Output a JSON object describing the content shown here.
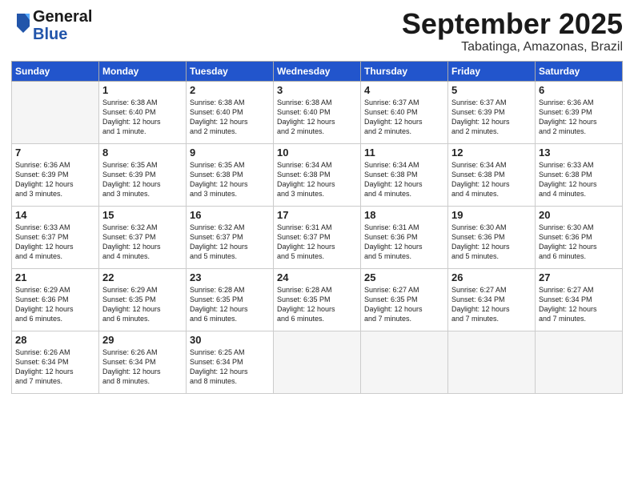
{
  "logo": {
    "line1": "General",
    "line2": "Blue"
  },
  "title": "September 2025",
  "location": "Tabatinga, Amazonas, Brazil",
  "days_of_week": [
    "Sunday",
    "Monday",
    "Tuesday",
    "Wednesday",
    "Thursday",
    "Friday",
    "Saturday"
  ],
  "weeks": [
    [
      {
        "num": "",
        "text": ""
      },
      {
        "num": "1",
        "text": "Sunrise: 6:38 AM\nSunset: 6:40 PM\nDaylight: 12 hours\nand 1 minute."
      },
      {
        "num": "2",
        "text": "Sunrise: 6:38 AM\nSunset: 6:40 PM\nDaylight: 12 hours\nand 2 minutes."
      },
      {
        "num": "3",
        "text": "Sunrise: 6:38 AM\nSunset: 6:40 PM\nDaylight: 12 hours\nand 2 minutes."
      },
      {
        "num": "4",
        "text": "Sunrise: 6:37 AM\nSunset: 6:40 PM\nDaylight: 12 hours\nand 2 minutes."
      },
      {
        "num": "5",
        "text": "Sunrise: 6:37 AM\nSunset: 6:39 PM\nDaylight: 12 hours\nand 2 minutes."
      },
      {
        "num": "6",
        "text": "Sunrise: 6:36 AM\nSunset: 6:39 PM\nDaylight: 12 hours\nand 2 minutes."
      }
    ],
    [
      {
        "num": "7",
        "text": "Sunrise: 6:36 AM\nSunset: 6:39 PM\nDaylight: 12 hours\nand 3 minutes."
      },
      {
        "num": "8",
        "text": "Sunrise: 6:35 AM\nSunset: 6:39 PM\nDaylight: 12 hours\nand 3 minutes."
      },
      {
        "num": "9",
        "text": "Sunrise: 6:35 AM\nSunset: 6:38 PM\nDaylight: 12 hours\nand 3 minutes."
      },
      {
        "num": "10",
        "text": "Sunrise: 6:34 AM\nSunset: 6:38 PM\nDaylight: 12 hours\nand 3 minutes."
      },
      {
        "num": "11",
        "text": "Sunrise: 6:34 AM\nSunset: 6:38 PM\nDaylight: 12 hours\nand 4 minutes."
      },
      {
        "num": "12",
        "text": "Sunrise: 6:34 AM\nSunset: 6:38 PM\nDaylight: 12 hours\nand 4 minutes."
      },
      {
        "num": "13",
        "text": "Sunrise: 6:33 AM\nSunset: 6:38 PM\nDaylight: 12 hours\nand 4 minutes."
      }
    ],
    [
      {
        "num": "14",
        "text": "Sunrise: 6:33 AM\nSunset: 6:37 PM\nDaylight: 12 hours\nand 4 minutes."
      },
      {
        "num": "15",
        "text": "Sunrise: 6:32 AM\nSunset: 6:37 PM\nDaylight: 12 hours\nand 4 minutes."
      },
      {
        "num": "16",
        "text": "Sunrise: 6:32 AM\nSunset: 6:37 PM\nDaylight: 12 hours\nand 5 minutes."
      },
      {
        "num": "17",
        "text": "Sunrise: 6:31 AM\nSunset: 6:37 PM\nDaylight: 12 hours\nand 5 minutes."
      },
      {
        "num": "18",
        "text": "Sunrise: 6:31 AM\nSunset: 6:36 PM\nDaylight: 12 hours\nand 5 minutes."
      },
      {
        "num": "19",
        "text": "Sunrise: 6:30 AM\nSunset: 6:36 PM\nDaylight: 12 hours\nand 5 minutes."
      },
      {
        "num": "20",
        "text": "Sunrise: 6:30 AM\nSunset: 6:36 PM\nDaylight: 12 hours\nand 6 minutes."
      }
    ],
    [
      {
        "num": "21",
        "text": "Sunrise: 6:29 AM\nSunset: 6:36 PM\nDaylight: 12 hours\nand 6 minutes."
      },
      {
        "num": "22",
        "text": "Sunrise: 6:29 AM\nSunset: 6:35 PM\nDaylight: 12 hours\nand 6 minutes."
      },
      {
        "num": "23",
        "text": "Sunrise: 6:28 AM\nSunset: 6:35 PM\nDaylight: 12 hours\nand 6 minutes."
      },
      {
        "num": "24",
        "text": "Sunrise: 6:28 AM\nSunset: 6:35 PM\nDaylight: 12 hours\nand 6 minutes."
      },
      {
        "num": "25",
        "text": "Sunrise: 6:27 AM\nSunset: 6:35 PM\nDaylight: 12 hours\nand 7 minutes."
      },
      {
        "num": "26",
        "text": "Sunrise: 6:27 AM\nSunset: 6:34 PM\nDaylight: 12 hours\nand 7 minutes."
      },
      {
        "num": "27",
        "text": "Sunrise: 6:27 AM\nSunset: 6:34 PM\nDaylight: 12 hours\nand 7 minutes."
      }
    ],
    [
      {
        "num": "28",
        "text": "Sunrise: 6:26 AM\nSunset: 6:34 PM\nDaylight: 12 hours\nand 7 minutes."
      },
      {
        "num": "29",
        "text": "Sunrise: 6:26 AM\nSunset: 6:34 PM\nDaylight: 12 hours\nand 8 minutes."
      },
      {
        "num": "30",
        "text": "Sunrise: 6:25 AM\nSunset: 6:34 PM\nDaylight: 12 hours\nand 8 minutes."
      },
      {
        "num": "",
        "text": ""
      },
      {
        "num": "",
        "text": ""
      },
      {
        "num": "",
        "text": ""
      },
      {
        "num": "",
        "text": ""
      }
    ]
  ]
}
